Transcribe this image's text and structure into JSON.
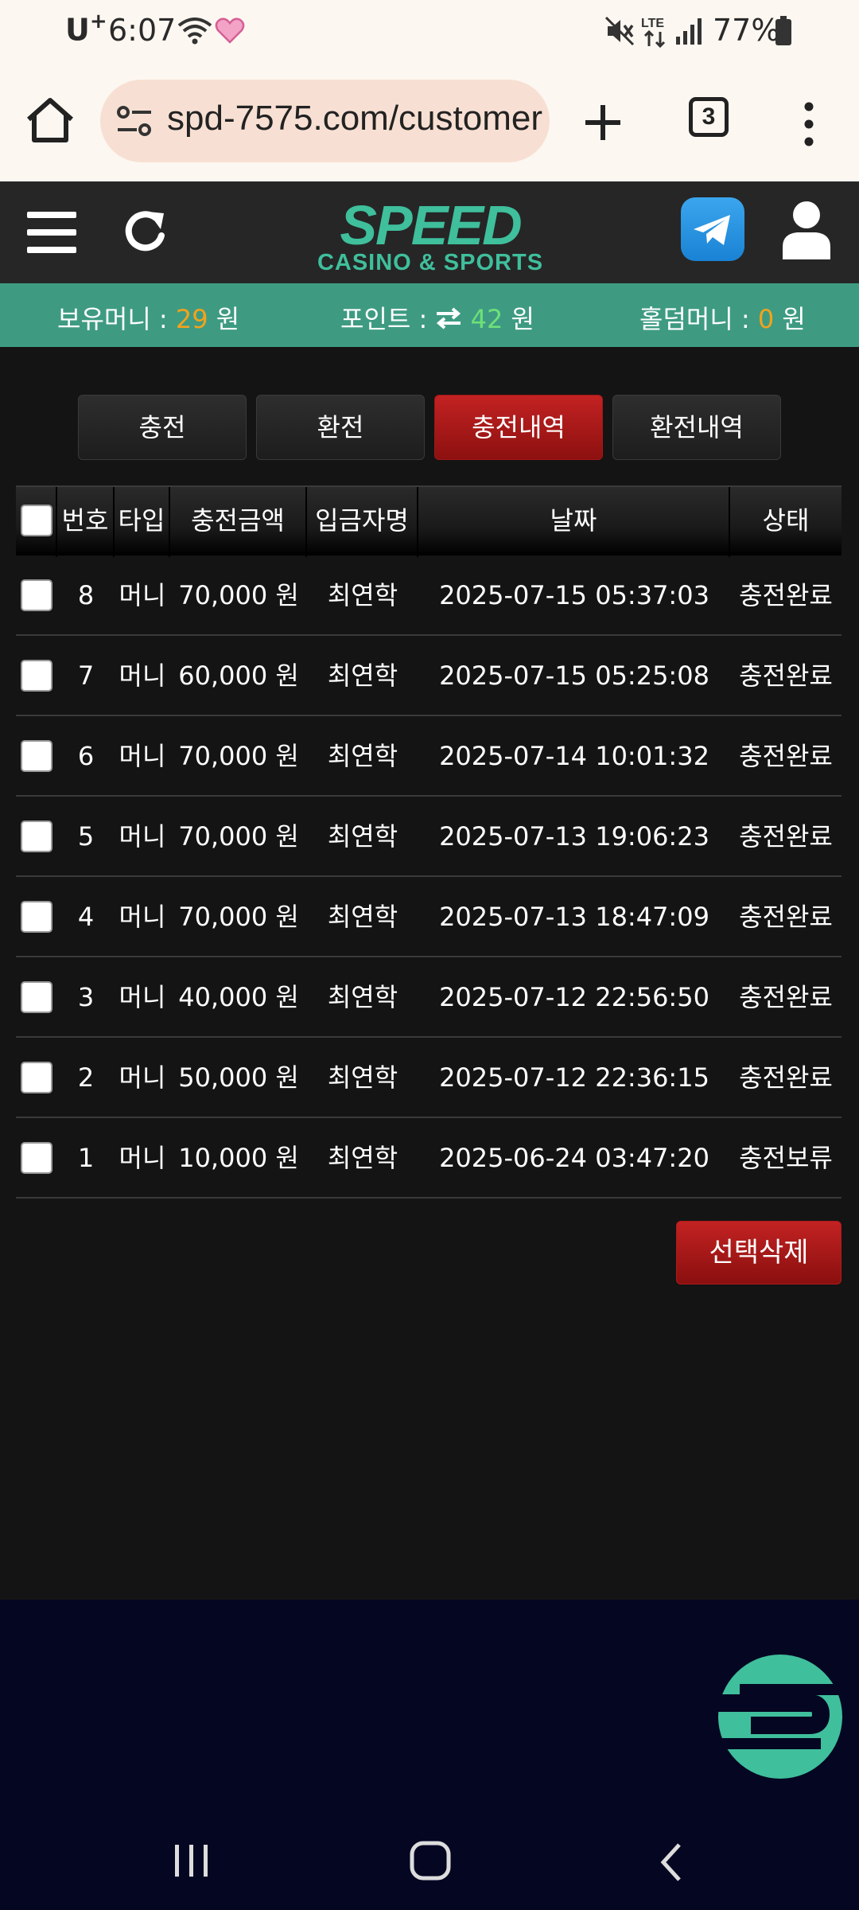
{
  "status_bar": {
    "carrier": "U",
    "carrier_sup": "+",
    "time": "6:07",
    "battery": "77%"
  },
  "browser": {
    "url": "spd-7575.com/customer",
    "tab_count": "3"
  },
  "header": {
    "logo": "SPEED",
    "logo_sub": "CASINO & SPORTS",
    "accent": "#3fbf9c"
  },
  "balance": {
    "money_label": "보유머니 : ",
    "money_value": "29",
    "money_unit": " 원",
    "point_label": "포인트 : ",
    "point_value": "42",
    "point_unit": " 원",
    "holdem_label": "홀덤머니 : ",
    "holdem_value": "0",
    "holdem_unit": " 원"
  },
  "tabs": [
    {
      "label": "충전"
    },
    {
      "label": "환전"
    },
    {
      "label": "충전내역",
      "active": true
    },
    {
      "label": "환전내역"
    }
  ],
  "table": {
    "headers": [
      "번호",
      "타입",
      "충전금액",
      "입금자명",
      "날짜",
      "상태"
    ],
    "rows": [
      {
        "no": "8",
        "type": "머니",
        "amount": "70,000 원",
        "name": "최연학",
        "date": "2025-07-15 05:37:03",
        "status": "충전완료"
      },
      {
        "no": "7",
        "type": "머니",
        "amount": "60,000 원",
        "name": "최연학",
        "date": "2025-07-15 05:25:08",
        "status": "충전완료"
      },
      {
        "no": "6",
        "type": "머니",
        "amount": "70,000 원",
        "name": "최연학",
        "date": "2025-07-14 10:01:32",
        "status": "충전완료"
      },
      {
        "no": "5",
        "type": "머니",
        "amount": "70,000 원",
        "name": "최연학",
        "date": "2025-07-13 19:06:23",
        "status": "충전완료"
      },
      {
        "no": "4",
        "type": "머니",
        "amount": "70,000 원",
        "name": "최연학",
        "date": "2025-07-13 18:47:09",
        "status": "충전완료"
      },
      {
        "no": "3",
        "type": "머니",
        "amount": "40,000 원",
        "name": "최연학",
        "date": "2025-07-12 22:56:50",
        "status": "충전완료"
      },
      {
        "no": "2",
        "type": "머니",
        "amount": "50,000 원",
        "name": "최연학",
        "date": "2025-07-12 22:36:15",
        "status": "충전완료"
      },
      {
        "no": "1",
        "type": "머니",
        "amount": "10,000 원",
        "name": "최연학",
        "date": "2025-06-24 03:47:20",
        "status": "충전보류"
      }
    ]
  },
  "delete_button": "선택삭제"
}
